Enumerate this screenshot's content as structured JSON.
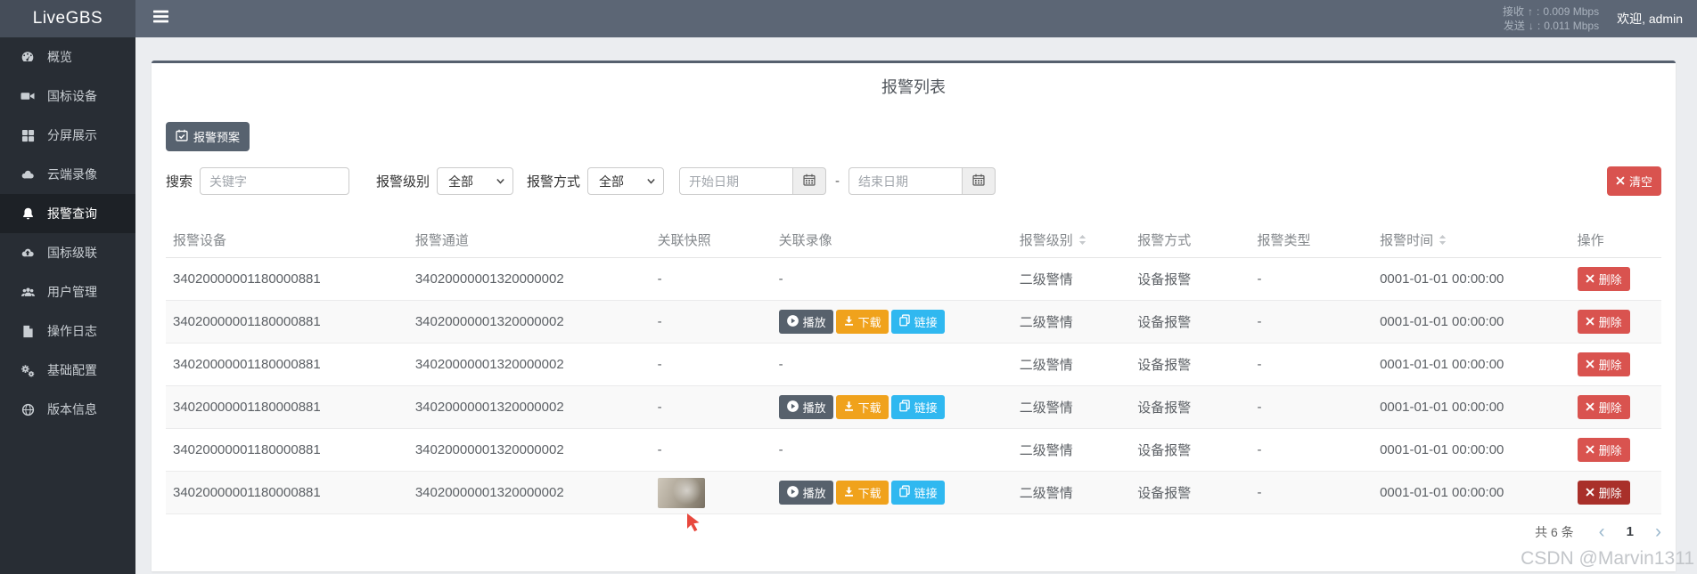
{
  "topbar": {
    "logo": "LiveGBS",
    "net": {
      "recv_label": "接收",
      "recv_arrow": "↑",
      "sep": ":",
      "recv_value": "0.009 Mbps",
      "send_label": "发送",
      "send_arrow": "↓",
      "send_value": "0.011 Mbps"
    },
    "welcome": "欢迎, admin"
  },
  "sidebar": {
    "items": [
      {
        "label": "概览",
        "icon": "dashboard-icon",
        "active": false
      },
      {
        "label": "国标设备",
        "icon": "video-camera-icon",
        "active": false
      },
      {
        "label": "分屏展示",
        "icon": "grid-icon",
        "active": false
      },
      {
        "label": "云端录像",
        "icon": "cloud-icon",
        "active": false
      },
      {
        "label": "报警查询",
        "icon": "bell-icon",
        "active": true
      },
      {
        "label": "国标级联",
        "icon": "cloud-upload-icon",
        "active": false
      },
      {
        "label": "用户管理",
        "icon": "users-icon",
        "active": false
      },
      {
        "label": "操作日志",
        "icon": "file-icon",
        "active": false
      },
      {
        "label": "基础配置",
        "icon": "cogs-icon",
        "active": false
      },
      {
        "label": "版本信息",
        "icon": "globe-icon",
        "active": false
      }
    ]
  },
  "main": {
    "title": "报警列表",
    "plan_button": {
      "label": "报警预案",
      "icon": "calendar-check-icon",
      "color": "#57626f"
    },
    "filters": {
      "search_label": "搜索",
      "search_placeholder": "关键字",
      "level_label": "报警级别",
      "level_value": "全部",
      "method_label": "报警方式",
      "method_value": "全部",
      "start_placeholder": "开始日期",
      "range_separator": "-",
      "end_placeholder": "结束日期",
      "clear_button": {
        "label": "清空",
        "icon": "x-icon",
        "color": "#d9534f"
      }
    },
    "table": {
      "headers": [
        {
          "key": "device",
          "label": "报警设备",
          "sortable": false
        },
        {
          "key": "channel",
          "label": "报警通道",
          "sortable": false
        },
        {
          "key": "snapshot",
          "label": "关联快照",
          "sortable": false
        },
        {
          "key": "video",
          "label": "关联录像",
          "sortable": false
        },
        {
          "key": "level",
          "label": "报警级别",
          "sortable": true
        },
        {
          "key": "method",
          "label": "报警方式",
          "sortable": false
        },
        {
          "key": "type",
          "label": "报警类型",
          "sortable": false
        },
        {
          "key": "time",
          "label": "报警时间",
          "sortable": true
        },
        {
          "key": "actions",
          "label": "操作",
          "sortable": false
        }
      ],
      "video_actions": [
        {
          "label": "播放",
          "icon": "play-icon",
          "color": "#57616c"
        },
        {
          "label": "下载",
          "icon": "download-icon",
          "color": "#f0a21c"
        },
        {
          "label": "链接",
          "icon": "copy-icon",
          "color": "#30b8f0"
        }
      ],
      "delete_action": {
        "label": "删除",
        "icon": "x-icon",
        "color": "#d9534f",
        "pressed_color": "#a9302a"
      },
      "rows": [
        {
          "device": "34020000001180000881",
          "channel": "34020000001320000002",
          "snapshot": "-",
          "video": "-",
          "level": "二级警情",
          "method": "设备报警",
          "type": "-",
          "time": "0001-01-01 00:00:00",
          "delete_pressed": false
        },
        {
          "device": "34020000001180000881",
          "channel": "34020000001320000002",
          "snapshot": "-",
          "video": "buttons",
          "level": "二级警情",
          "method": "设备报警",
          "type": "-",
          "time": "0001-01-01 00:00:00",
          "delete_pressed": false
        },
        {
          "device": "34020000001180000881",
          "channel": "34020000001320000002",
          "snapshot": "-",
          "video": "-",
          "level": "二级警情",
          "method": "设备报警",
          "type": "-",
          "time": "0001-01-01 00:00:00",
          "delete_pressed": false
        },
        {
          "device": "34020000001180000881",
          "channel": "34020000001320000002",
          "snapshot": "-",
          "video": "buttons",
          "level": "二级警情",
          "method": "设备报警",
          "type": "-",
          "time": "0001-01-01 00:00:00",
          "delete_pressed": false
        },
        {
          "device": "34020000001180000881",
          "channel": "34020000001320000002",
          "snapshot": "-",
          "video": "-",
          "level": "二级警情",
          "method": "设备报警",
          "type": "-",
          "time": "0001-01-01 00:00:00",
          "delete_pressed": false
        },
        {
          "device": "34020000001180000881",
          "channel": "34020000001320000002",
          "snapshot": "image",
          "video": "buttons",
          "level": "二级警情",
          "method": "设备报警",
          "type": "-",
          "time": "0001-01-01 00:00:00",
          "delete_pressed": true
        }
      ]
    },
    "footer": {
      "total": "共 6 条",
      "pager": {
        "prev": "‹",
        "page": "1",
        "next": "›"
      }
    }
  },
  "watermark": "CSDN @Marvin1311",
  "colors": {
    "danger": "#d9534f",
    "warning": "#f0a21c",
    "info": "#30b8f0",
    "dark": "#57616c"
  }
}
